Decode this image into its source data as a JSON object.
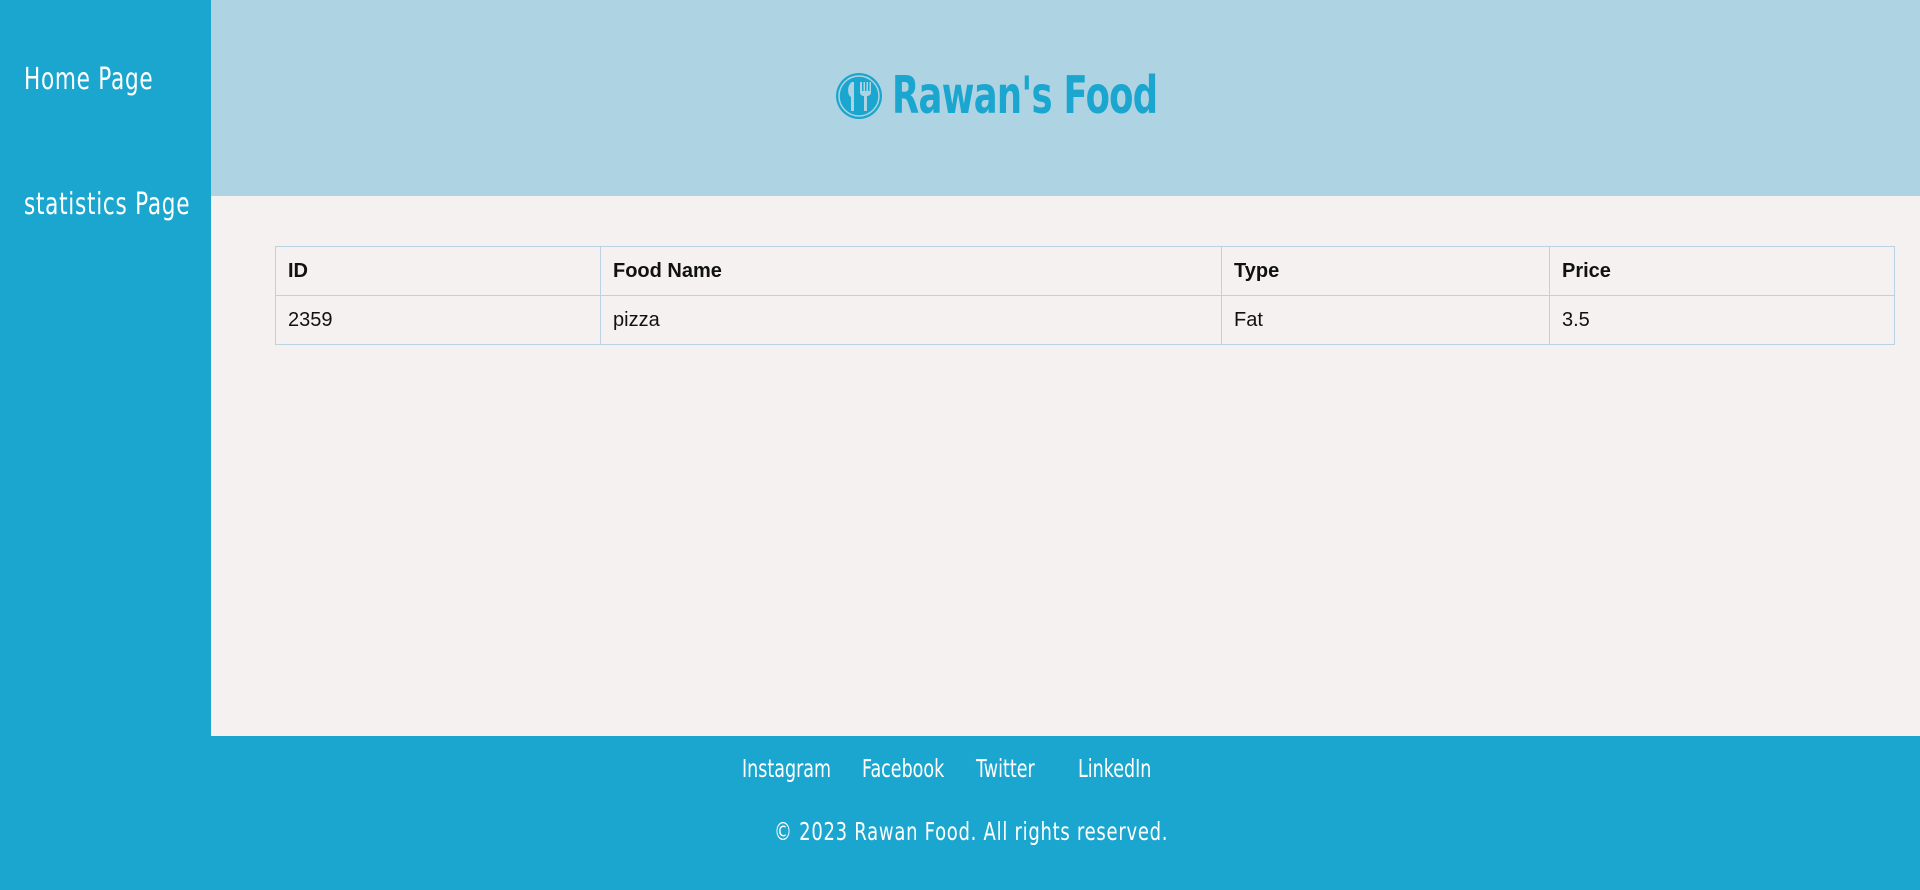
{
  "sidebar": {
    "items": [
      {
        "label": "Home Page"
      },
      {
        "label": "statistics Page"
      }
    ]
  },
  "header": {
    "logo_icon": "fork-knife-icon",
    "title": "Rawan's Food",
    "accent_color": "#1aa6cf",
    "background_color": "#aed3e3"
  },
  "table": {
    "columns": [
      "ID",
      "Food Name",
      "Type",
      "Price"
    ],
    "rows": [
      [
        "2359",
        "pizza",
        "Fat",
        "3.5"
      ]
    ]
  },
  "footer": {
    "links": [
      "Instagram",
      "Facebook",
      "Twitter",
      "LinkedIn"
    ],
    "copyright": "© 2023 Rawan Food. All rights reserved.",
    "background_color": "#1aa6cf"
  }
}
